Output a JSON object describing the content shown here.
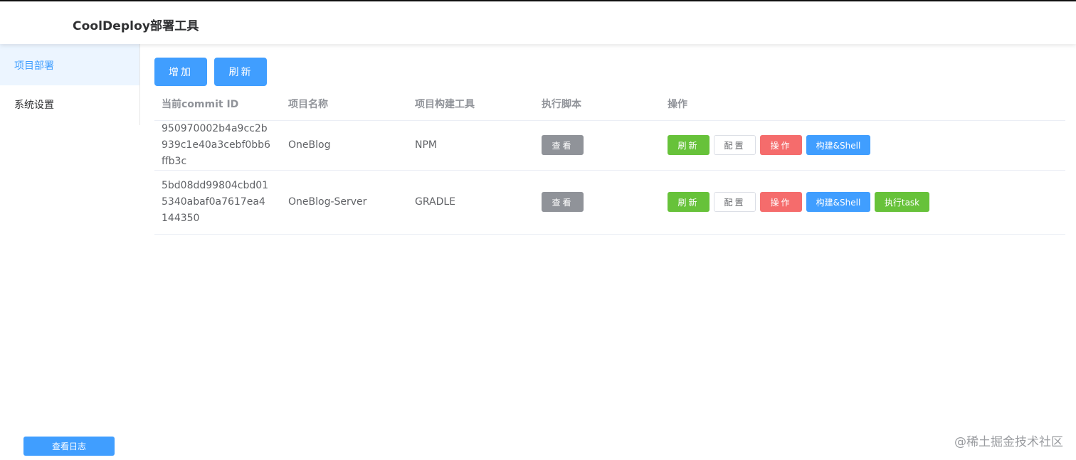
{
  "header": {
    "title": "CoolDeploy部署工具"
  },
  "sidebar": {
    "items": [
      {
        "label": "项目部署",
        "active": true
      },
      {
        "label": "系统设置",
        "active": false
      }
    ],
    "log_button": "查看日志"
  },
  "toolbar": {
    "add_label": "增加",
    "refresh_label": "刷新"
  },
  "table": {
    "columns": [
      "当前commit ID",
      "项目名称",
      "项目构建工具",
      "执行脚本",
      "操作"
    ],
    "rows": [
      {
        "commit_id": "950970002b4a9cc2b939c1e40a3cebf0bb6ffb3c",
        "name": "OneBlog",
        "build_tool": "NPM",
        "script_button": "查看",
        "actions": {
          "refresh": "刷新",
          "config": "配置",
          "operate": "操作",
          "build_shell": "构建&Shell"
        }
      },
      {
        "commit_id": "5bd08dd99804cbd015340abaf0a7617ea4144350",
        "name": "OneBlog-Server",
        "build_tool": "GRADLE",
        "script_button": "查看",
        "actions": {
          "refresh": "刷新",
          "config": "配置",
          "operate": "操作",
          "build_shell": "构建&Shell",
          "exec_task": "执行task"
        }
      }
    ]
  },
  "watermark": "@稀土掘金技术社区",
  "colors": {
    "primary": "#409eff",
    "success": "#67c23a",
    "danger": "#f56c6c",
    "info": "#909399",
    "active_bg": "#ecf5ff"
  }
}
